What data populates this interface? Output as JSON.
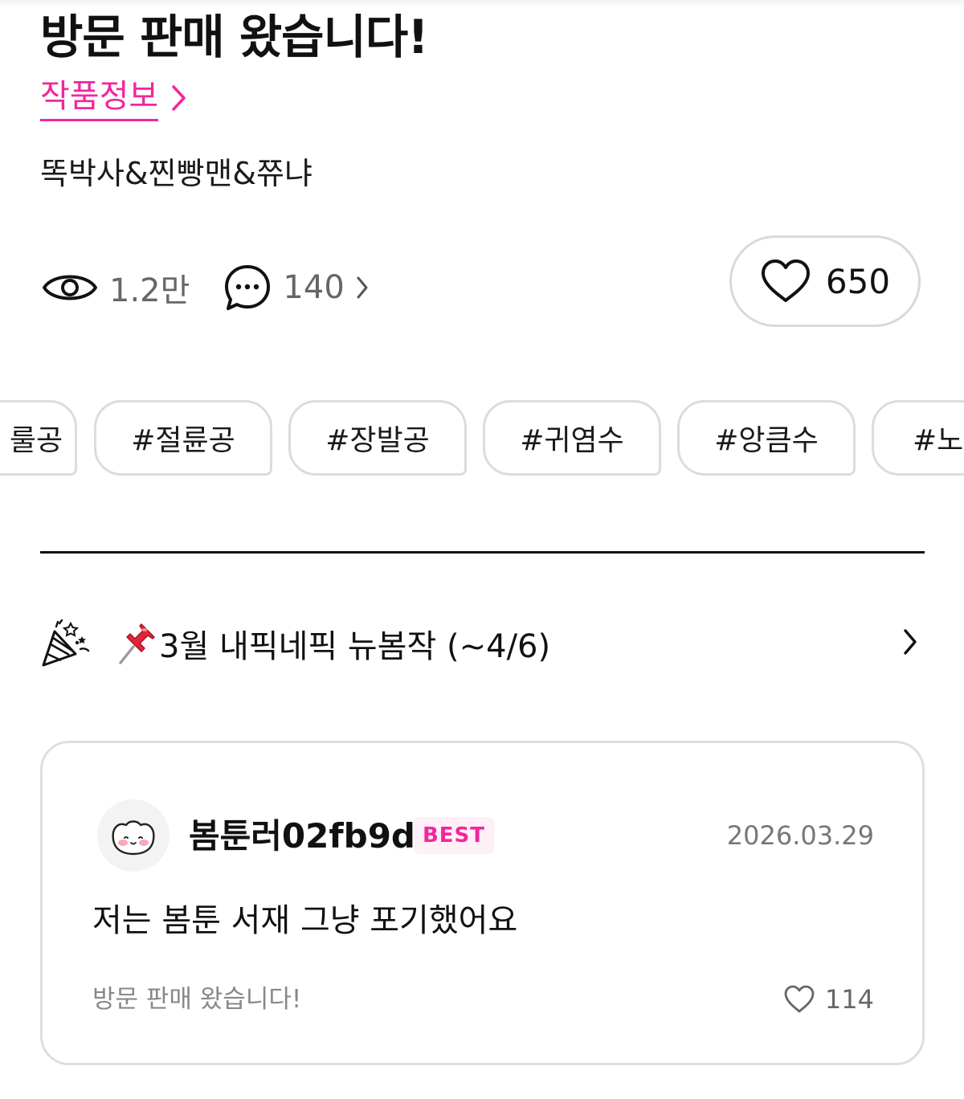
{
  "episode": {
    "title": "방문 판매 왔습니다!",
    "info_link_label": "작품정보",
    "authors": "똑박사&찐빵맨&쮸냐"
  },
  "stats": {
    "views": "1.2만",
    "comments": "140",
    "likes": "650"
  },
  "tags": [
    "룰공",
    "#절륜공",
    "#장발공",
    "#귀염수",
    "#앙큼수",
    "#노릇"
  ],
  "notice": {
    "text": "3월 내픽네픽 뉴봄작 (~4/6)"
  },
  "comment": {
    "username": "봄툰러02fb9d",
    "badge": "BEST",
    "date": "2026.03.29",
    "text": "저는 봄툰 서재 그냥 포기했어요",
    "source": "방문 판매 왔습니다!",
    "likes": "114"
  },
  "colors": {
    "accent": "#f1279d",
    "border": "#dcdcdc",
    "text": "#111111",
    "muted": "#666666"
  }
}
